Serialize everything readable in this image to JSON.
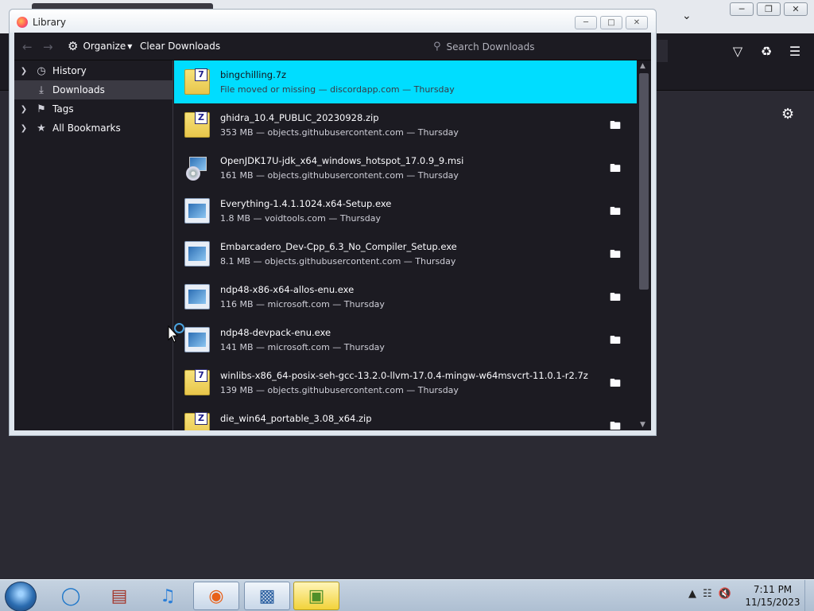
{
  "library": {
    "title": "Library",
    "toolbar": {
      "organize_label": "Organize",
      "clear_downloads_label": "Clear Downloads",
      "search_placeholder": "Search Downloads"
    },
    "sidebar": {
      "items": [
        {
          "label": "History",
          "icon": "clock-icon",
          "selected": false
        },
        {
          "label": "Downloads",
          "icon": "download-icon",
          "selected": true
        },
        {
          "label": "Tags",
          "icon": "tag-icon",
          "selected": false
        },
        {
          "label": "All Bookmarks",
          "icon": "star-icon",
          "selected": false
        }
      ]
    },
    "downloads": [
      {
        "name": "bingchilling.7z",
        "status": "File moved or missing — discordapp.com — Thursday",
        "icon": "7z-archive-icon",
        "selected": true
      },
      {
        "name": "ghidra_10.4_PUBLIC_20230928.zip",
        "status": "353 MB — objects.githubusercontent.com — Thursday",
        "icon": "zip-archive-icon"
      },
      {
        "name": "OpenJDK17U-jdk_x64_windows_hotspot_17.0.9_9.msi",
        "status": "161 MB — objects.githubusercontent.com — Thursday",
        "icon": "msi-installer-icon"
      },
      {
        "name": "Everything-1.4.1.1024.x64-Setup.exe",
        "status": "1.8 MB — voidtools.com — Thursday",
        "icon": "exe-file-icon"
      },
      {
        "name": "Embarcadero_Dev-Cpp_6.3_No_Compiler_Setup.exe",
        "status": "8.1 MB — objects.githubusercontent.com — Thursday",
        "icon": "exe-file-icon"
      },
      {
        "name": "ndp48-x86-x64-allos-enu.exe",
        "status": "116 MB — microsoft.com — Thursday",
        "icon": "exe-file-icon"
      },
      {
        "name": "ndp48-devpack-enu.exe",
        "status": "141 MB — microsoft.com — Thursday",
        "icon": "exe-file-icon"
      },
      {
        "name": "winlibs-x86_64-posix-seh-gcc-13.2.0-llvm-17.0.4-mingw-w64msvcrt-11.0.1-r2.7z",
        "status": "139 MB — objects.githubusercontent.com — Thursday",
        "icon": "7z-archive-icon"
      },
      {
        "name": "die_win64_portable_3.08_x64.zip",
        "status": "",
        "icon": "zip-archive-icon"
      }
    ]
  },
  "taskbar": {
    "clock_time": "7:11 PM",
    "clock_date": "11/15/2023",
    "apps": [
      "internet-explorer",
      "archive-manager",
      "itunes",
      "firefox",
      "virtualbox",
      "minecraft"
    ]
  }
}
